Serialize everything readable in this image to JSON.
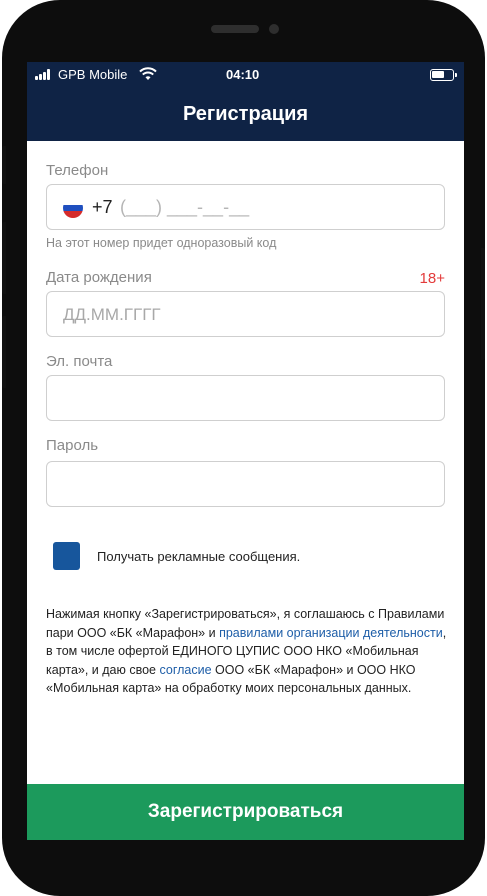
{
  "status_bar": {
    "carrier": "GPB Mobile",
    "time": "04:10"
  },
  "header": {
    "title": "Регистрация"
  },
  "form": {
    "phone": {
      "label": "Телефон",
      "country_code": "+7",
      "mask": "(___) ___-__-__",
      "hint": "На этот номер придет одноразовый код"
    },
    "birthdate": {
      "label": "Дата рождения",
      "age_badge": "18+",
      "placeholder": "ДД.ММ.ГГГГ"
    },
    "email": {
      "label": "Эл. почта",
      "value": ""
    },
    "password": {
      "label": "Пароль",
      "value": ""
    },
    "ads_checkbox": {
      "label": "Получать рекламные сообщения.",
      "checked": true
    }
  },
  "terms": {
    "t1": "Нажимая кнопку «Зарегистрироваться», я соглашаюсь с Правилами пари ООО «БК «Марафон» и ",
    "link1": "правилами организации деятельности",
    "t2": ", в том числе офертой ЕДИНОГО ЦУПИС ООО НКО «Мобильная карта», и даю свое ",
    "link2": "согласие",
    "t3": " ООО «БК «Марафон» и ООО НКО «Мобильная карта» на обработку моих персональных данных."
  },
  "register_button": {
    "label": "Зарегистрироваться"
  },
  "colors": {
    "header_bg": "#0f2345",
    "register_bg": "#1c9a5c",
    "checkbox": "#17569c",
    "link": "#1e5ea8",
    "age_badge": "#e33b3b"
  },
  "icons": [
    "signal-icon",
    "wifi-icon",
    "battery-icon",
    "russia-flag-icon"
  ]
}
